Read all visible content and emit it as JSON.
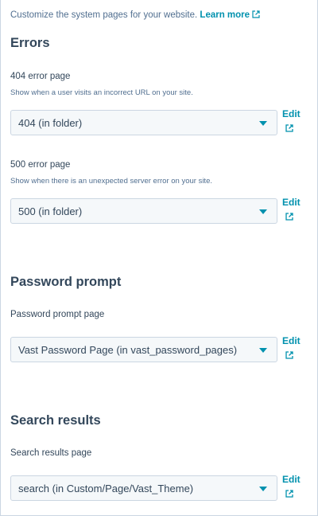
{
  "intro": {
    "text": "Customize the system pages for your website.",
    "link_label": "Learn more",
    "link_icon": "external-link-icon"
  },
  "errors": {
    "heading": "Errors",
    "error404": {
      "label": "404 error page",
      "help": "Show when a user visits an incorrect URL on your site.",
      "selected": "404 (in folder)",
      "edit_label": "Edit"
    },
    "error500": {
      "label": "500 error page",
      "help": "Show when there is an unexpected server error on your site.",
      "selected": "500 (in folder)",
      "edit_label": "Edit"
    }
  },
  "password": {
    "heading": "Password prompt",
    "label": "Password prompt page",
    "selected": "Vast Password Page (in vast_password_pages)",
    "edit_label": "Edit"
  },
  "search": {
    "heading": "Search results",
    "label": "Search results page",
    "selected": "search (in Custom/Page/Vast_Theme)",
    "edit_label": "Edit"
  },
  "colors": {
    "accent": "#0091ae",
    "text": "#33475b",
    "muted": "#516f90",
    "border": "#cbd6e2",
    "field_bg": "#f5f8fa"
  }
}
